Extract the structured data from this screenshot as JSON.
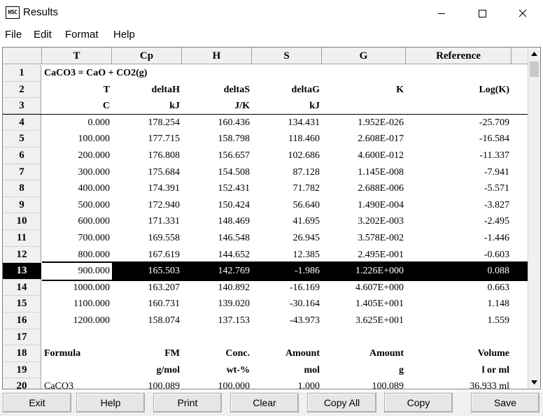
{
  "window": {
    "app_icon_text": "HSC",
    "title": "Results",
    "icons": {
      "minimize": "minimize-icon",
      "maximize": "maximize-icon",
      "close": "close-icon"
    }
  },
  "menu": [
    "File",
    "Edit",
    "Format",
    "Help"
  ],
  "grid": {
    "column_headers": [
      "T",
      "Cp",
      "H",
      "S",
      "G",
      "Reference"
    ],
    "rows": [
      {
        "num": "1",
        "cells": [
          "CaCO3 = CaO + CO2(g)",
          "",
          "",
          "",
          "",
          ""
        ]
      },
      {
        "num": "2",
        "cells": [
          "T",
          "deltaH",
          "deltaS",
          "deltaG",
          "K",
          "Log(K)"
        ]
      },
      {
        "num": "3",
        "cells": [
          "C",
          "kJ",
          "J/K",
          "kJ",
          "",
          ""
        ]
      },
      {
        "num": "4",
        "cells": [
          "0.000",
          "178.254",
          "160.436",
          "134.431",
          "1.952E-026",
          "-25.709"
        ]
      },
      {
        "num": "5",
        "cells": [
          "100.000",
          "177.715",
          "158.798",
          "118.460",
          "2.608E-017",
          "-16.584"
        ]
      },
      {
        "num": "6",
        "cells": [
          "200.000",
          "176.808",
          "156.657",
          "102.686",
          "4.600E-012",
          "-11.337"
        ]
      },
      {
        "num": "7",
        "cells": [
          "300.000",
          "175.684",
          "154.508",
          "87.128",
          "1.145E-008",
          "-7.941"
        ]
      },
      {
        "num": "8",
        "cells": [
          "400.000",
          "174.391",
          "152.431",
          "71.782",
          "2.688E-006",
          "-5.571"
        ]
      },
      {
        "num": "9",
        "cells": [
          "500.000",
          "172.940",
          "150.424",
          "56.640",
          "1.490E-004",
          "-3.827"
        ]
      },
      {
        "num": "10",
        "cells": [
          "600.000",
          "171.331",
          "148.469",
          "41.695",
          "3.202E-003",
          "-2.495"
        ]
      },
      {
        "num": "11",
        "cells": [
          "700.000",
          "169.558",
          "146.548",
          "26.945",
          "3.578E-002",
          "-1.446"
        ]
      },
      {
        "num": "12",
        "cells": [
          "800.000",
          "167.619",
          "144.652",
          "12.385",
          "2.495E-001",
          "-0.603"
        ]
      },
      {
        "num": "13",
        "cells": [
          "900.000",
          "165.503",
          "142.769",
          "-1.986",
          "1.226E+000",
          "0.088"
        ]
      },
      {
        "num": "14",
        "cells": [
          "1000.000",
          "163.207",
          "140.892",
          "-16.169",
          "4.607E+000",
          "0.663"
        ]
      },
      {
        "num": "15",
        "cells": [
          "1100.000",
          "160.731",
          "139.020",
          "-30.164",
          "1.405E+001",
          "1.148"
        ]
      },
      {
        "num": "16",
        "cells": [
          "1200.000",
          "158.074",
          "137.153",
          "-43.973",
          "3.625E+001",
          "1.559"
        ]
      },
      {
        "num": "17",
        "cells": [
          "",
          "",
          "",
          "",
          "",
          ""
        ]
      },
      {
        "num": "18",
        "cells": [
          "Formula",
          "FM",
          "Conc.",
          "Amount",
          "Amount",
          "Volume"
        ]
      },
      {
        "num": "19",
        "cells": [
          "",
          "g/mol",
          "wt-%",
          "mol",
          "g",
          "l or ml"
        ]
      },
      {
        "num": "20",
        "cells": [
          "CaCO3",
          "100.089",
          "100.000",
          "1.000",
          "100.089",
          "36.933 ml"
        ]
      }
    ],
    "selected_row": "13"
  },
  "buttons": [
    "Exit",
    "Help",
    "Print",
    "Clear",
    "Copy All",
    "Copy",
    "Save"
  ]
}
